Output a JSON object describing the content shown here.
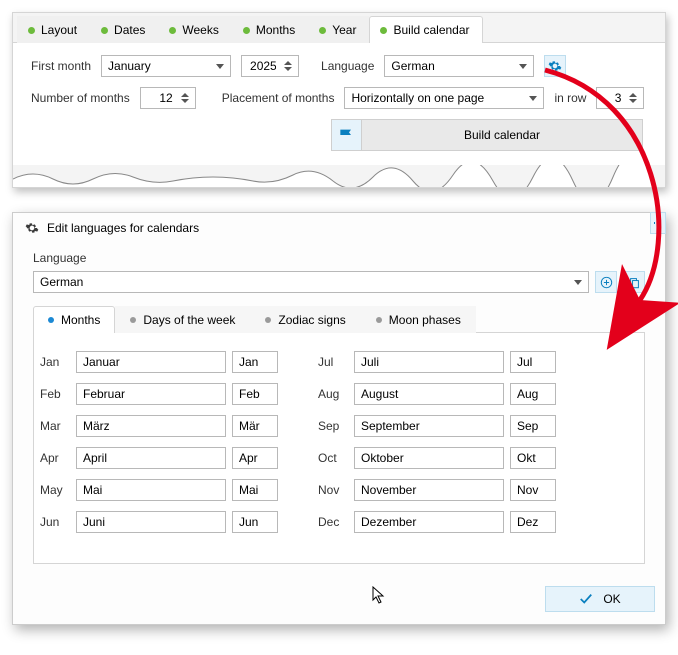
{
  "tabs": {
    "layout": "Layout",
    "dates": "Dates",
    "weeks": "Weeks",
    "months": "Months",
    "year": "Year",
    "build": "Build calendar"
  },
  "form": {
    "first_month_lbl": "First month",
    "first_month_val": "January",
    "year_val": "2025",
    "language_lbl": "Language",
    "language_val": "German",
    "num_months_lbl": "Number of months",
    "num_months_val": "12",
    "placement_lbl": "Placement of months",
    "placement_val": "Horizontally on one page",
    "in_row_lbl": "in row",
    "in_row_val": "3",
    "build_btn": "Build calendar"
  },
  "dialog": {
    "title": "Edit languages for calendars",
    "language_lbl": "Language",
    "language_val": "German",
    "subtabs": {
      "months": "Months",
      "days": "Days of the week",
      "zodiac": "Zodiac signs",
      "moon": "Moon phases"
    },
    "months_left": [
      {
        "key": "Jan",
        "long": "Januar",
        "short": "Jan"
      },
      {
        "key": "Feb",
        "long": "Februar",
        "short": "Feb"
      },
      {
        "key": "Mar",
        "long": "März",
        "short": "Mär"
      },
      {
        "key": "Apr",
        "long": "April",
        "short": "Apr"
      },
      {
        "key": "May",
        "long": "Mai",
        "short": "Mai"
      },
      {
        "key": "Jun",
        "long": "Juni",
        "short": "Jun"
      }
    ],
    "months_right": [
      {
        "key": "Jul",
        "long": "Juli",
        "short": "Jul"
      },
      {
        "key": "Aug",
        "long": "August",
        "short": "Aug"
      },
      {
        "key": "Sep",
        "long": "September",
        "short": "Sep"
      },
      {
        "key": "Oct",
        "long": "Oktober",
        "short": "Okt"
      },
      {
        "key": "Nov",
        "long": "November",
        "short": "Nov"
      },
      {
        "key": "Dec",
        "long": "Dezember",
        "short": "Dez"
      }
    ],
    "ok": "OK"
  }
}
